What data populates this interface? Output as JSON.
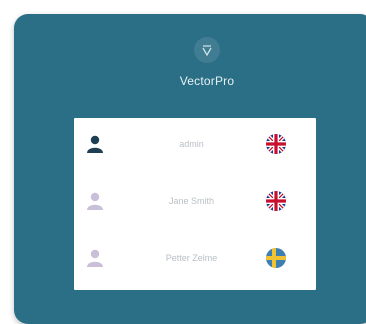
{
  "app": {
    "name": "VectorPro",
    "logo_icon": "vectorpro-logo-icon"
  },
  "colors": {
    "panel": "#2b6f86",
    "admin_avatar": "#1f3f52",
    "user_avatar": "#c9bfd8"
  },
  "users": [
    {
      "name": "admin",
      "avatar_icon": "user-icon",
      "language_icon": "uk-flag-icon"
    },
    {
      "name": "Jane Smith",
      "avatar_icon": "user-icon",
      "language_icon": "uk-flag-icon"
    },
    {
      "name": "Petter Zelme",
      "avatar_icon": "user-icon",
      "language_icon": "sweden-flag-icon"
    }
  ]
}
